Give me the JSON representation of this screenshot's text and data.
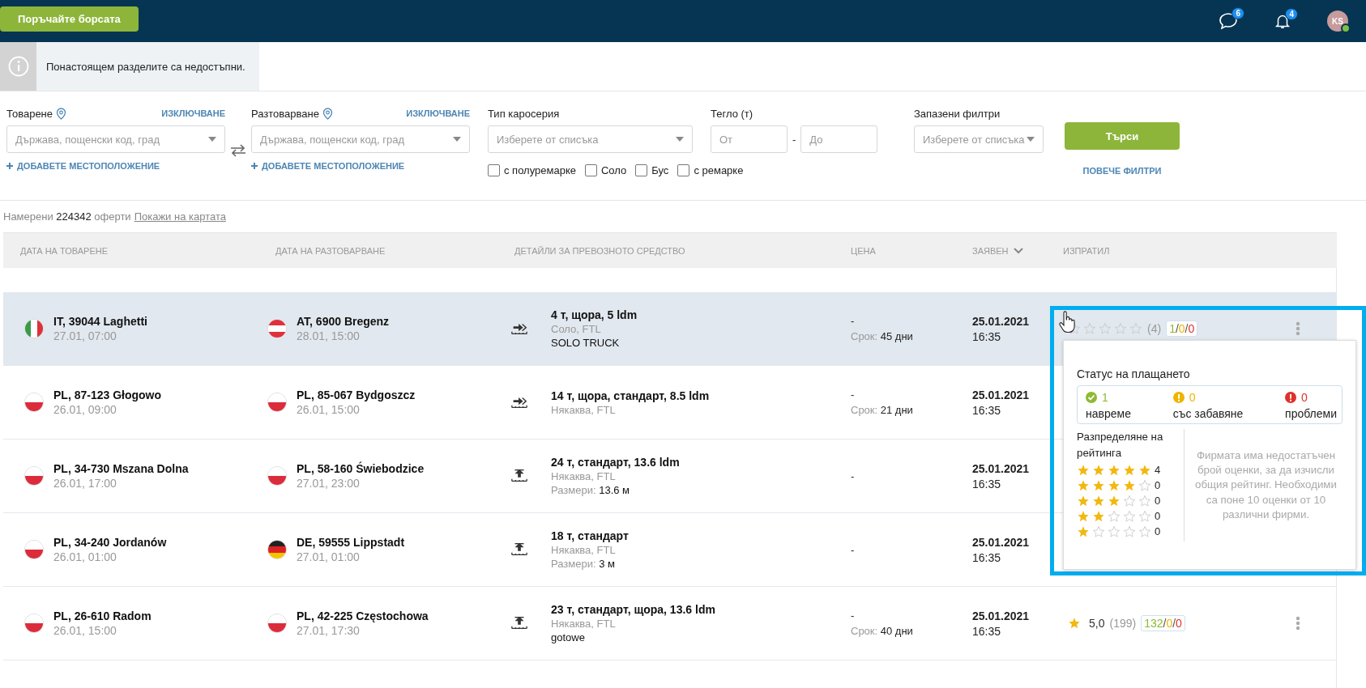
{
  "topbar": {
    "order_button": "Поръчайте борсата",
    "messages_badge": "6",
    "notifications_badge": "4",
    "avatar": "KS",
    "online": true
  },
  "info": {
    "message": "Понастоящем разделите са недостъпни."
  },
  "filters": {
    "loading": {
      "label": "Товарене",
      "exclude": "ИЗКЛЮЧВАНЕ",
      "placeholder": "Държава, пощенски код, град",
      "add": "ДОБАВЕТЕ МЕСТОПОЛОЖЕНИЕ"
    },
    "unloading": {
      "label": "Разтоварване",
      "exclude": "ИЗКЛЮЧВАНЕ",
      "placeholder": "Държава, пощенски код, град",
      "add": "ДОБАВЕТЕ МЕСТОПОЛОЖЕНИЕ"
    },
    "body_type": {
      "label": "Тип каросерия",
      "placeholder": "Изберете от списъка",
      "options": [
        {
          "label": "с полуремарке",
          "checked": false
        },
        {
          "label": "Соло",
          "checked": false
        },
        {
          "label": "Бус",
          "checked": false
        },
        {
          "label": "с ремарке",
          "checked": false
        }
      ]
    },
    "weight": {
      "label": "Тегло (т)",
      "from_placeholder": "От",
      "separator": "-",
      "to_placeholder": "До"
    },
    "saved_filters": {
      "label": "Запазени филтри",
      "placeholder": "Изберете от списъка"
    },
    "search_button": "Търси",
    "more_filters": "ПОВЕЧЕ ФИЛТРИ"
  },
  "results": {
    "prefix": "Намерени",
    "count": "224342",
    "suffix": "оферти",
    "map_link": "Покажи на картата"
  },
  "table": {
    "columns": [
      {
        "label": "ДАТА НА ТОВАРЕНЕ",
        "sorted": false
      },
      {
        "label": "ДАТА НА РАЗТОВАРВАНЕ",
        "sorted": false
      },
      {
        "label": "ДЕТАЙЛИ ЗА ПРЕВОЗНОТО СРЕДСТВО",
        "sorted": false
      },
      {
        "label": "ЦЕНА",
        "sorted": false
      },
      {
        "label": "ЗАЯВЕН",
        "sorted": true
      },
      {
        "label": "ИЗПРАТИЛ",
        "sorted": false
      }
    ],
    "rows": [
      {
        "highlighted": true,
        "loading": {
          "flag": {
            "kind": "it"
          },
          "place": "IT, 39044 Laghetti",
          "date": "27.01, 07:00"
        },
        "unloading": {
          "flag": {
            "kind": "at"
          },
          "place": "AT, 6900 Bregenz",
          "date": "28.01, 15:00"
        },
        "vehicle": {
          "kind": "side",
          "title": "4 т, щора, 5 ldm",
          "body": "Соло, FTL",
          "note": "SOLO TRUCK"
        },
        "price": {
          "value": "-",
          "term_label": "Срок:",
          "term": "45 дни"
        },
        "posted": {
          "date": "25.01.2021",
          "time": "16:35"
        },
        "sender": {
          "kind": "stars",
          "stars": 0,
          "reviews": "(4)",
          "payments": {
            "on_time": "1",
            "delayed": "0",
            "problems": "0",
            "separator": "/"
          }
        }
      },
      {
        "highlighted": false,
        "loading": {
          "flag": {
            "kind": "pl"
          },
          "place": "PL, 87-123 Głogowo",
          "date": "26.01, 09:00"
        },
        "unloading": {
          "flag": {
            "kind": "pl"
          },
          "place": "PL, 85-067 Bydgoszcz",
          "date": "26.01, 15:00"
        },
        "vehicle": {
          "kind": "side",
          "title": "14 т, щора, стандарт, 8.5 ldm",
          "body": "Някаква, FTL"
        },
        "price": {
          "value": "-",
          "term_label": "Срок:",
          "term": "21 дни"
        },
        "posted": {
          "date": "25.01.2021",
          "time": "16:35"
        }
      },
      {
        "highlighted": false,
        "loading": {
          "flag": {
            "kind": "pl"
          },
          "place": "PL, 34-730 Mszana Dolna",
          "date": "26.01, 17:00"
        },
        "unloading": {
          "flag": {
            "kind": "pl"
          },
          "place": "PL, 58-160 Świebodzice",
          "date": "27.01, 23:00"
        },
        "vehicle": {
          "kind": "top",
          "title": "24 т, стандарт, 13.6 ldm",
          "body": "Някаква, FTL",
          "dimensions": {
            "label": "Размери:",
            "value": "13.6 м"
          }
        },
        "price": {
          "value": "-"
        },
        "posted": {
          "date": "25.01.2021",
          "time": "16:35"
        }
      },
      {
        "highlighted": false,
        "loading": {
          "flag": {
            "kind": "pl"
          },
          "place": "PL, 34-240 Jordanów",
          "date": "26.01, 01:00"
        },
        "unloading": {
          "flag": {
            "kind": "de"
          },
          "place": "DE, 59555 Lippstadt",
          "date": "27.01, 01:00"
        },
        "vehicle": {
          "kind": "top",
          "title": "18 т, стандарт",
          "body": "Някаква, FTL",
          "dimensions": {
            "label": "Размери:",
            "value": "3 м"
          }
        },
        "price": {
          "value": "-"
        },
        "posted": {
          "date": "25.01.2021",
          "time": "16:35"
        }
      },
      {
        "highlighted": false,
        "loading": {
          "flag": {
            "kind": "pl"
          },
          "place": "PL, 26-610 Radom",
          "date": "26.01, 15:00"
        },
        "unloading": {
          "flag": {
            "kind": "pl"
          },
          "place": "PL, 42-225 Częstochowa",
          "date": "27.01, 17:30"
        },
        "vehicle": {
          "kind": "top",
          "title": "23 т, стандарт, щора, 13.6 ldm",
          "body": "Някаква, FTL",
          "note": "gotowe"
        },
        "price": {
          "value": "-",
          "term_label": "Срок:",
          "term": "40 дни"
        },
        "posted": {
          "date": "25.01.2021",
          "time": "16:35"
        },
        "sender": {
          "kind": "score",
          "score": "5,0",
          "reviews": "(199)",
          "payments": {
            "on_time": "132",
            "delayed": "0",
            "problems": "0",
            "separator": "/"
          }
        }
      }
    ]
  },
  "popover": {
    "payment_title": "Статус на плащането",
    "payment_status": [
      {
        "kind": "ok",
        "count": "1",
        "label": "навреме"
      },
      {
        "kind": "warning",
        "count": "0",
        "label": "със забавяне"
      },
      {
        "kind": "error",
        "count": "0",
        "label": "проблеми"
      }
    ],
    "distribution_title": "Разпределяне на рейтинга",
    "distribution": [
      {
        "stars": 5,
        "count": "4"
      },
      {
        "stars": 4,
        "count": "0"
      },
      {
        "stars": 3,
        "count": "0"
      },
      {
        "stars": 2,
        "count": "0"
      },
      {
        "stars": 1,
        "count": "0"
      }
    ],
    "note": "Фирмата има недостатъчен брой оценки, за да изчисли общия рейтинг. Необходими са поне 10 оценки от 10 различни фирми."
  }
}
